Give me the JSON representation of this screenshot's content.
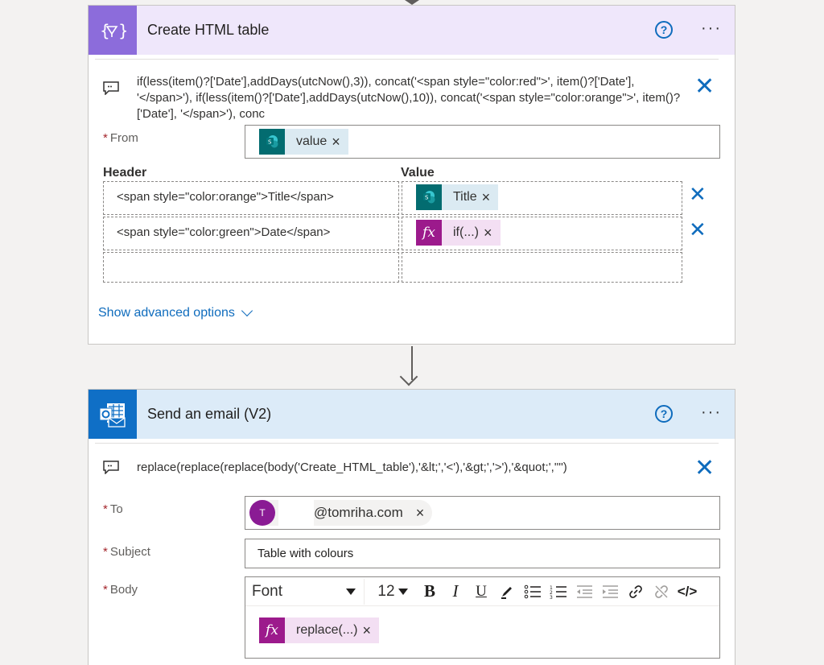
{
  "action1": {
    "title": "Create HTML table",
    "formula": "if(less(item()?['Date'],addDays(utcNow(),3)), concat('<span style=\"color:red\">', item()?['Date'], '</span>'), if(less(item()?['Date'],addDays(utcNow(),10)), concat('<span style=\"color:orange\">', item()?['Date'], '</span>'), conc",
    "from_label": "From",
    "from_token": "value",
    "header_col": "Header",
    "value_col": "Value",
    "rows": [
      {
        "header": "<span style=\"color:orange\">Title</span>",
        "value": "Title",
        "value_type": "sharepoint"
      },
      {
        "header": "<span style=\"color:green\">Date</span>",
        "value": "if(...)",
        "value_type": "expression"
      }
    ],
    "advanced": "Show advanced options"
  },
  "action2": {
    "title": "Send an email (V2)",
    "formula": "replace(replace(replace(body('Create_HTML_table'),'&lt;','<'),'&gt;','>'),'&quot;','\"')",
    "to_label": "To",
    "to_avatar": "T",
    "to_email": "@tomriha.com",
    "subject_label": "Subject",
    "subject_value": "Table with colours",
    "body_label": "Body",
    "font_value": "Font",
    "size_value": "12",
    "body_token": "replace(...)"
  },
  "colors": {
    "accent": "#0f6cbd",
    "table_header_bg": "#efe7fb",
    "email_header_bg": "#dcebf8",
    "sharepoint": "#036c70",
    "expression": "#9c1a8c"
  }
}
